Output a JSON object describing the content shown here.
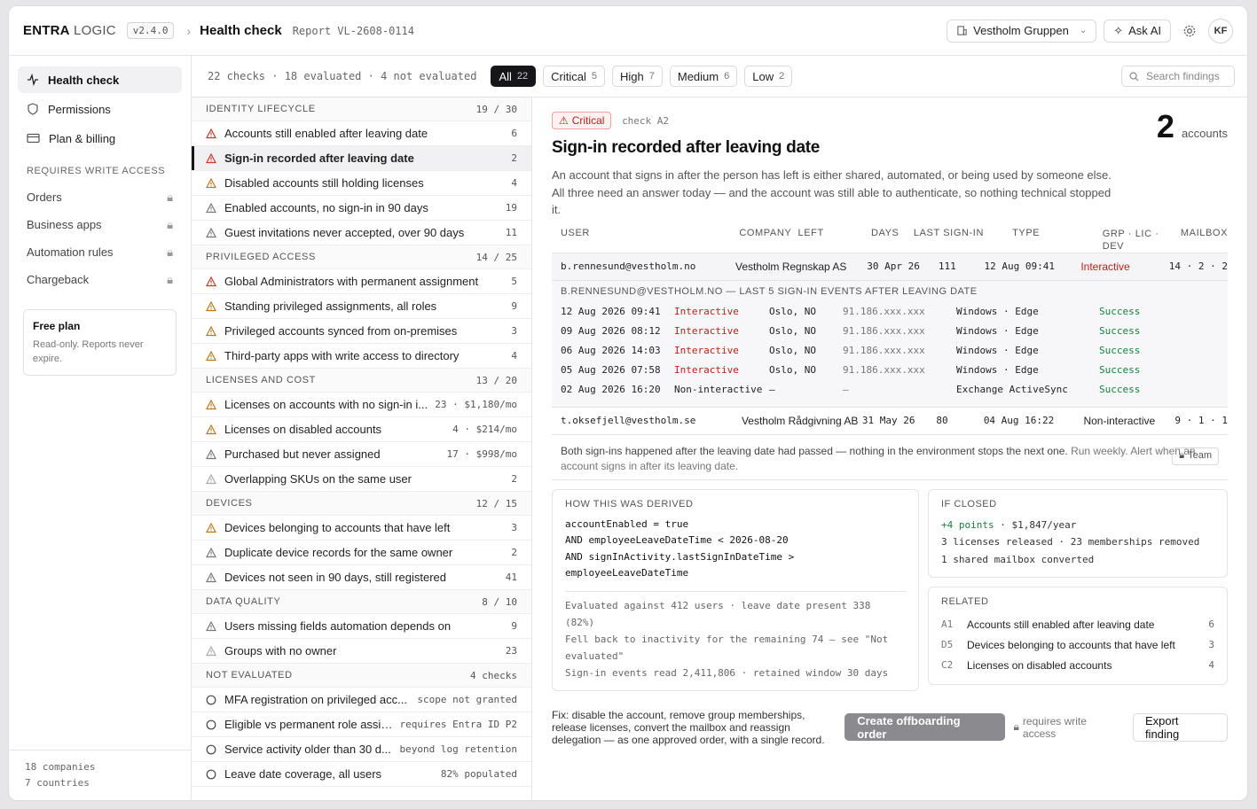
{
  "app": {
    "brand_strong": "ENTRA",
    "brand_light": "LOGIC",
    "version": "v2.4.0",
    "crumb": "Health check",
    "report": "Report VL-2608-0114"
  },
  "header": {
    "org": "Vestholm Gruppen",
    "ask_ai": "Ask AI",
    "avatar": "KF"
  },
  "sidebar": {
    "items": [
      {
        "label": "Health check"
      },
      {
        "label": "Permissions"
      },
      {
        "label": "Plan & billing"
      }
    ],
    "section": "REQUIRES WRITE ACCESS",
    "locked": [
      {
        "label": "Orders"
      },
      {
        "label": "Business apps"
      },
      {
        "label": "Automation rules"
      },
      {
        "label": "Chargeback"
      }
    ],
    "plan_title": "Free plan",
    "plan_text": "Read-only. Reports never expire.",
    "footer": [
      "18 companies",
      "7 countries"
    ]
  },
  "filters": {
    "summary": "22 checks · 18 evaluated · 4 not evaluated",
    "chips": [
      {
        "label": "All",
        "count": "22"
      },
      {
        "label": "Critical",
        "count": "5"
      },
      {
        "label": "High",
        "count": "7"
      },
      {
        "label": "Medium",
        "count": "6"
      },
      {
        "label": "Low",
        "count": "2"
      }
    ],
    "search_placeholder": "Search findings"
  },
  "groups": [
    {
      "title": "IDENTITY LIFECYCLE",
      "count": "19 / 30",
      "rows": [
        {
          "label": "Accounts still enabled after leaving date",
          "count": "6",
          "sev": "crit"
        },
        {
          "label": "Sign-in recorded after leaving date",
          "count": "2",
          "sev": "crit"
        },
        {
          "label": "Disabled accounts still holding licenses",
          "count": "4",
          "sev": "high"
        },
        {
          "label": "Enabled accounts, no sign-in in 90 days",
          "count": "19",
          "sev": "med"
        },
        {
          "label": "Guest invitations never accepted, over 90 days",
          "count": "11",
          "sev": "med"
        }
      ]
    },
    {
      "title": "PRIVILEGED ACCESS",
      "count": "14 / 25",
      "rows": [
        {
          "label": "Global Administrators with permanent assignment",
          "count": "5",
          "sev": "crit"
        },
        {
          "label": "Standing privileged assignments, all roles",
          "count": "9",
          "sev": "high"
        },
        {
          "label": "Privileged accounts synced from on-premises",
          "count": "3",
          "sev": "high"
        },
        {
          "label": "Third-party apps with write access to directory",
          "count": "4",
          "sev": "high"
        }
      ]
    },
    {
      "title": "LICENSES AND COST",
      "count": "13 / 20",
      "rows": [
        {
          "label": "Licenses on accounts with no sign-in i...",
          "count": "23 · $1,180/mo",
          "sev": "high"
        },
        {
          "label": "Licenses on disabled accounts",
          "count": "4 · $214/mo",
          "sev": "high"
        },
        {
          "label": "Purchased but never assigned",
          "count": "17 · $998/mo",
          "sev": "med"
        },
        {
          "label": "Overlapping SKUs on the same user",
          "count": "2",
          "sev": "low"
        }
      ]
    },
    {
      "title": "DEVICES",
      "count": "12 / 15",
      "rows": [
        {
          "label": "Devices belonging to accounts that have left",
          "count": "3",
          "sev": "high"
        },
        {
          "label": "Duplicate device records for the same owner",
          "count": "2",
          "sev": "med"
        },
        {
          "label": "Devices not seen in 90 days, still registered",
          "count": "41",
          "sev": "med"
        }
      ]
    },
    {
      "title": "DATA QUALITY",
      "count": "8 / 10",
      "rows": [
        {
          "label": "Users missing fields automation depends on",
          "count": "9",
          "sev": "med"
        },
        {
          "label": "Groups with no owner",
          "count": "23",
          "sev": "low"
        }
      ]
    },
    {
      "title": "NOT EVALUATED",
      "count": "4 checks",
      "rows": [
        {
          "label": "MFA registration on privileged acc...",
          "count": "scope not granted",
          "sev": "ne"
        },
        {
          "label": "Eligible vs permanent role assig...",
          "count": "requires Entra ID P2",
          "sev": "ne"
        },
        {
          "label": "Service activity older than 30 d...",
          "count": "beyond log retention",
          "sev": "ne"
        },
        {
          "label": "Leave date coverage, all users",
          "count": "82% populated",
          "sev": "ne"
        }
      ]
    }
  ],
  "detail": {
    "badge": "Critical",
    "check": "check A2",
    "count": "2",
    "count_unit": "accounts",
    "title": "Sign-in recorded after leaving date",
    "desc": "An account that signs in after the person has left is either shared, automated, or being used by someone else. All three need an answer today — and the account was still able to authenticate, so nothing technical stopped it.",
    "columns": [
      "USER",
      "COMPANY",
      "LEFT",
      "DAYS",
      "LAST SIGN-IN",
      "TYPE",
      "GRP · LIC · DEV",
      "MAILBOX"
    ],
    "accounts": [
      {
        "user": "b.rennesund@vestholm.no",
        "company": "Vestholm Regnskap AS",
        "left": "30 Apr 26",
        "days": "111",
        "last": "12 Aug 09:41",
        "type": "Interactive",
        "grp": "14 · 2 · 2"
      },
      {
        "user": "t.oksefjell@vestholm.se",
        "company": "Vestholm Rådgivning AB",
        "left": "31 May 26",
        "days": "80",
        "last": "04 Aug 16:22",
        "type": "Non-interactive",
        "grp": "9 · 1 · 1"
      }
    ],
    "events_title": "B.RENNESUND@VESTHOLM.NO — LAST 5 SIGN-IN EVENTS AFTER LEAVING DATE",
    "events": [
      {
        "time": "12 Aug 2026 09:41",
        "type": "Interactive",
        "loc": "Oslo, NO",
        "ip": "91.186.xxx.xxx",
        "client": "Windows · Edge",
        "result": "Success"
      },
      {
        "time": "09 Aug 2026 08:12",
        "type": "Interactive",
        "loc": "Oslo, NO",
        "ip": "91.186.xxx.xxx",
        "client": "Windows · Edge",
        "result": "Success"
      },
      {
        "time": "06 Aug 2026 14:03",
        "type": "Interactive",
        "loc": "Oslo, NO",
        "ip": "91.186.xxx.xxx",
        "client": "Windows · Edge",
        "result": "Success"
      },
      {
        "time": "05 Aug 2026 07:58",
        "type": "Interactive",
        "loc": "Oslo, NO",
        "ip": "91.186.xxx.xxx",
        "client": "Windows · Edge",
        "result": "Success"
      },
      {
        "time": "02 Aug 2026 16:20",
        "type": "Non-interactive",
        "loc": "—",
        "ip": "—",
        "client": "Exchange ActiveSync",
        "result": "Success"
      }
    ],
    "note_main": "Both sign-ins happened after the leaving date had passed — nothing in the environment stops the next one.",
    "note_muted": "Run weekly. Alert when an account signs in after its leaving date.",
    "team": "Team",
    "derived_title": "HOW THIS WAS DERIVED",
    "derived_code": [
      "accountEnabled = true",
      "AND employeeLeaveDateTime < 2026-08-20",
      "AND signInActivity.lastSignInDateTime >",
      "employeeLeaveDateTime"
    ],
    "derived_meta": [
      "Evaluated against   412 users · leave date present 338 (82%)",
      "Fell back to inactivity for the remaining 74 — see \"Not",
      "evaluated\"",
      "Sign-in events read  2,411,806 · retained window 30 days"
    ],
    "closed_title": "IF CLOSED",
    "closed_points": "+4 points",
    "closed_year": " · $1,847/year",
    "closed_lines": [
      "3 licenses released · 23 memberships removed",
      "1 shared mailbox converted"
    ],
    "related_title": "RELATED",
    "related": [
      {
        "id": "A1",
        "label": "Accounts still enabled after leaving date",
        "count": "6"
      },
      {
        "id": "D5",
        "label": "Devices belonging to accounts that have left",
        "count": "3"
      },
      {
        "id": "C2",
        "label": "Licenses on disabled accounts",
        "count": "4"
      }
    ],
    "fix": "Fix: disable the account, remove group memberships, release licenses, convert the mailbox and reassign delegation — as one approved order, with a single record.",
    "cta": "Create offboarding order",
    "req": "requires write access",
    "export": "Export finding"
  }
}
